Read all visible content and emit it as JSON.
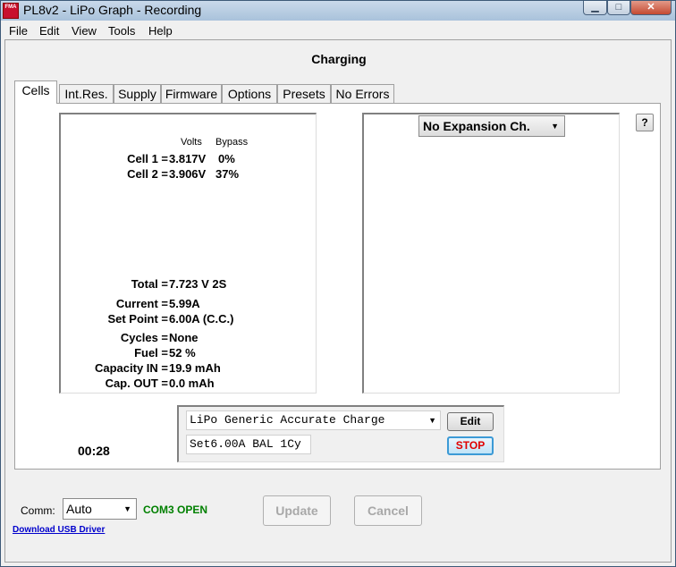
{
  "window": {
    "title": "PL8v2 - LiPo Graph - Recording",
    "app_icon_text": "FMA",
    "controls": {
      "minimize": "▁",
      "maximize": "□",
      "close": "✕"
    }
  },
  "menu": [
    "File",
    "Edit",
    "View",
    "Tools",
    "Help"
  ],
  "status_title": "Charging",
  "tabs": [
    "Cells",
    "Int.Res.",
    "Supply",
    "Firmware",
    "Options",
    "Presets",
    "No Errors"
  ],
  "active_tab": "Cells",
  "cells_panel": {
    "header_volts": "Volts",
    "header_bypass": "Bypass",
    "cells": [
      {
        "label": "Cell 1 =",
        "value": "3.817V",
        "bypass": "0%"
      },
      {
        "label": "Cell 2 =",
        "value": "3.906V",
        "bypass": "37%"
      }
    ],
    "stats": [
      {
        "label": "Total =",
        "value": "7.723 V  2S"
      },
      {
        "label": "Current =",
        "value": "5.99A"
      },
      {
        "label": "Set Point =",
        "value": "6.00A  (C.C.)"
      },
      {
        "label": "Cycles =",
        "value": "None"
      },
      {
        "label": "Fuel =",
        "value": "52 %"
      },
      {
        "label": "Capacity IN =",
        "value": "19.9 mAh"
      },
      {
        "label": "Cap. OUT =",
        "value": "0.0 mAh"
      }
    ]
  },
  "expansion": {
    "selected": "No Expansion Ch.",
    "help": "?"
  },
  "program": {
    "selected": "LiPo Generic Accurate Charge",
    "detail": "Set6.00A BAL 1Cy",
    "edit_label": "Edit",
    "stop_label": "STOP"
  },
  "timer": "00:28",
  "comm": {
    "label": "Comm:",
    "selected": "Auto",
    "status": "COM3 OPEN",
    "usb_link": "Download USB Driver"
  },
  "buttons": {
    "update": "Update",
    "cancel": "Cancel"
  },
  "colors": {
    "stop_text": "#e00000",
    "comm_status": "#008000",
    "link": "#0000cc"
  }
}
